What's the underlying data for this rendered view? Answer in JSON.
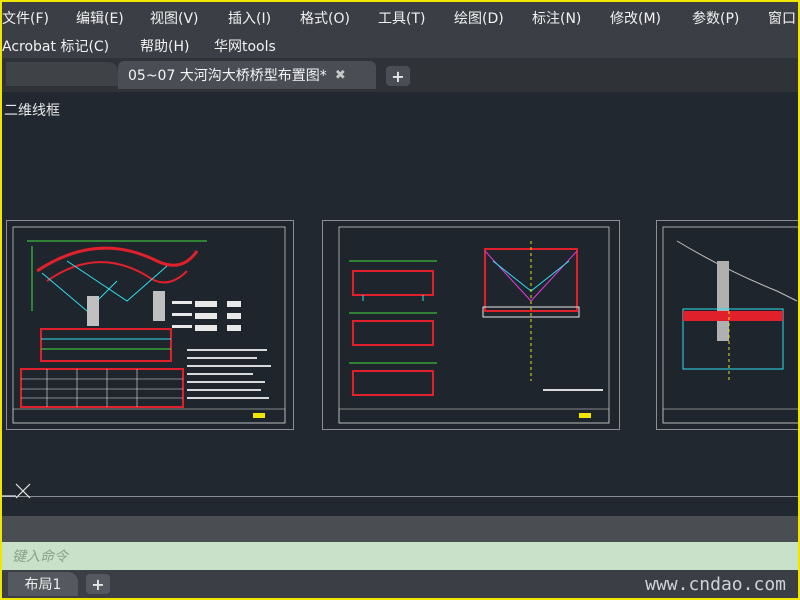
{
  "menu": {
    "row1": [
      "文件(F)",
      "编辑(E)",
      "视图(V)",
      "插入(I)",
      "格式(O)",
      "工具(T)",
      "绘图(D)",
      "标注(N)",
      "修改(M)",
      "参数(P)",
      "窗口"
    ],
    "row2": [
      "Acrobat 标记(C)",
      "帮助(H)",
      "华网tools"
    ]
  },
  "document_tab": {
    "title": "05~07 大河沟大桥桥型布置图*",
    "close": "✖",
    "add": "+"
  },
  "viewport_label": "二维线框",
  "command_line": {
    "placeholder": "键入命令"
  },
  "layout_tabs": {
    "tab1": "布局1",
    "add": "+"
  },
  "watermark": "www.cndao.com",
  "colors": {
    "canvas": "#212830",
    "accent_red": "#e0202a",
    "accent_cyan": "#30e0f0",
    "accent_green": "#40e040",
    "frame_yellow": "#f0e600"
  }
}
